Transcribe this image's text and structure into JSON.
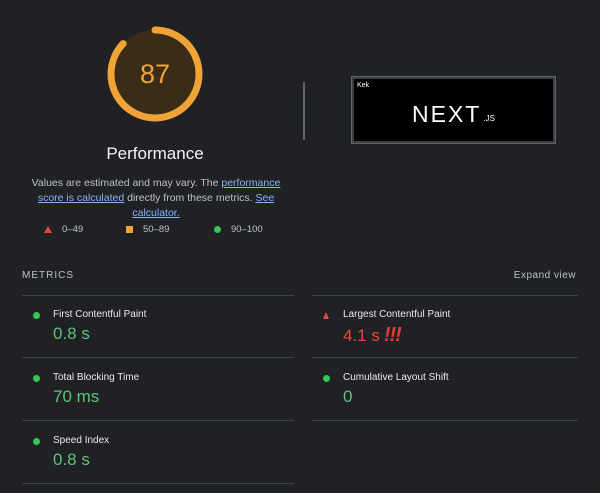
{
  "summary": {
    "score": "87",
    "score_fraction": 0.87,
    "title": "Performance",
    "desc_prefix": "Values are estimated and may vary. The ",
    "desc_link": "performance score is calculated",
    "desc_middle": " directly from these metrics. ",
    "desc_calc_link": "See calculator.",
    "legend": [
      {
        "icon": "red-triangle-icon",
        "label": "0–49"
      },
      {
        "icon": "orange-square-icon",
        "label": "50–89"
      },
      {
        "icon": "green-circle-icon",
        "label": "90–100"
      }
    ],
    "colors": {
      "fail": "#e8493a",
      "average": "#f0a336",
      "pass": "#5fc27a",
      "link": "#8ab4f8"
    }
  },
  "screenshot": {
    "label": "Kek",
    "logo_main": "NEXT",
    "logo_suffix": ".JS"
  },
  "metrics": {
    "title": "METRICS",
    "expand_label": "Expand view",
    "items": [
      {
        "name": "First Contentful Paint",
        "value": "0.8 s",
        "status": "pass"
      },
      {
        "name": "Largest Contentful Paint",
        "value": "4.1 s",
        "annotation": "!!!",
        "status": "fail"
      },
      {
        "name": "Total Blocking Time",
        "value": "70 ms",
        "status": "pass"
      },
      {
        "name": "Cumulative Layout Shift",
        "value": "0",
        "status": "pass"
      },
      {
        "name": "Speed Index",
        "value": "0.8 s",
        "status": "pass"
      }
    ]
  }
}
